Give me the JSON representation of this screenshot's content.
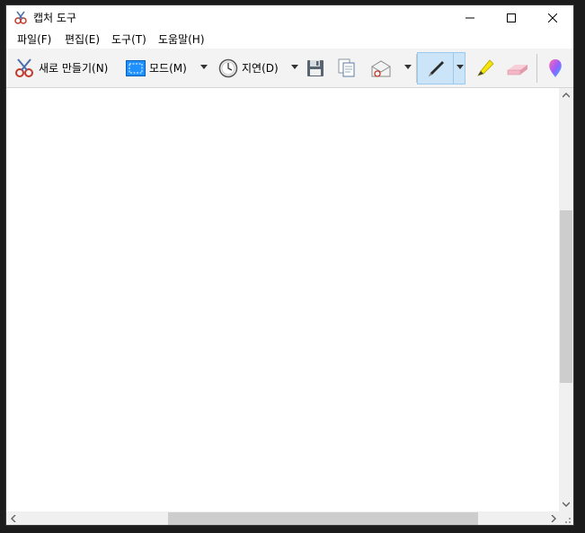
{
  "window": {
    "title": "캡처 도구"
  },
  "menu": [
    {
      "label": "파일(F)"
    },
    {
      "label": "편집(E)"
    },
    {
      "label": "도구(T)"
    },
    {
      "label": "도움말(H)"
    }
  ],
  "toolbar": {
    "new_label": "새로 만들기(N)",
    "mode_label": "모드(M)",
    "delay_label": "지연(D)"
  },
  "icons": {
    "app": "snipping-scissors-icon",
    "new": "scissors-icon",
    "mode": "rectangle-snip-icon",
    "delay": "clock-icon",
    "save": "save-icon",
    "copy": "copy-icon",
    "send": "email-icon",
    "pen": "pen-icon",
    "highlighter": "highlighter-icon",
    "eraser": "eraser-icon",
    "paint3d": "paint-3d-icon"
  },
  "colors": {
    "accent_blue": "#1e90ff",
    "selected_bg": "#cce4f7",
    "highlighter": "#f5e50a",
    "eraser": "#f2b8c6"
  }
}
